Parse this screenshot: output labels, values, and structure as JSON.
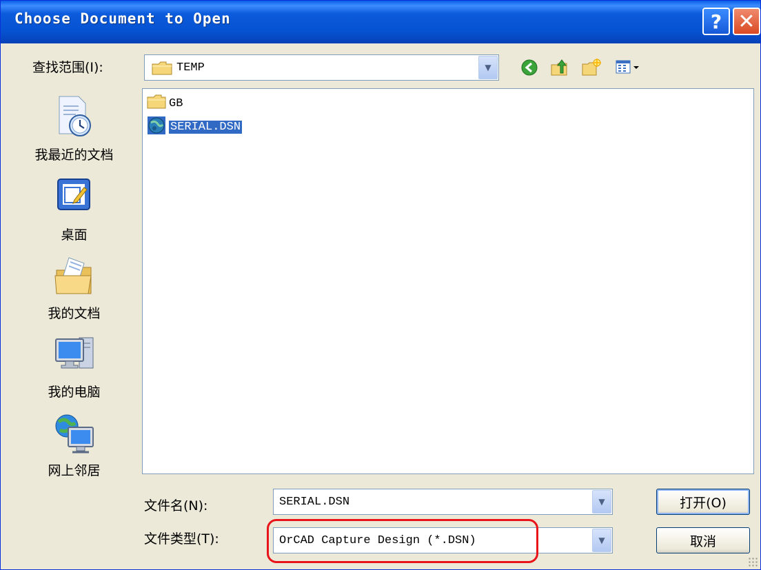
{
  "window": {
    "title": "Choose Document to Open",
    "help_glyph": "?",
    "close_glyph": "✕"
  },
  "lookin": {
    "label": "查找范围(I):",
    "value": "TEMP"
  },
  "toolbar": {
    "icons": [
      "back-icon",
      "up-folder-icon",
      "new-folder-icon",
      "view-menu-icon"
    ]
  },
  "places": [
    {
      "label": "我最近的文档",
      "icon": "recent-documents-icon"
    },
    {
      "label": "桌面",
      "icon": "desktop-icon"
    },
    {
      "label": "我的文档",
      "icon": "my-documents-icon"
    },
    {
      "label": "我的电脑",
      "icon": "my-computer-icon"
    },
    {
      "label": "网上邻居",
      "icon": "network-places-icon"
    }
  ],
  "files": [
    {
      "name": "GB",
      "icon": "folder-icon",
      "selected": false
    },
    {
      "name": "SERIAL.DSN",
      "icon": "design-file-icon",
      "selected": true
    }
  ],
  "filename": {
    "label": "文件名(N):",
    "value": "SERIAL.DSN"
  },
  "filetype": {
    "label": "文件类型(T):",
    "value": "OrCAD Capture Design (*.DSN)"
  },
  "buttons": {
    "open": "打开(O)",
    "cancel": "取消"
  },
  "colors": {
    "title_bar": "#0653d2",
    "selection": "#316ac5",
    "annotation": "#e8141a",
    "dialog_bg": "#ece9d8"
  }
}
